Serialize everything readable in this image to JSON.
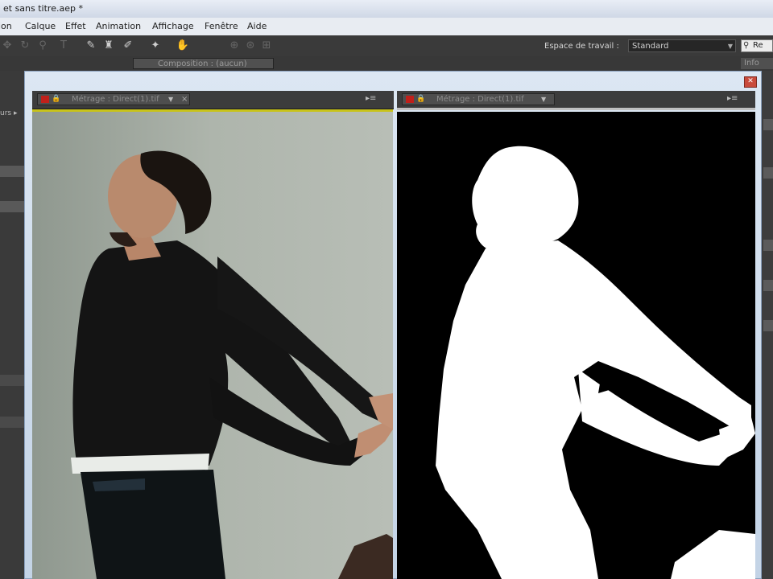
{
  "window": {
    "title": "et sans titre.aep *"
  },
  "menu": {
    "items": [
      "ion",
      "Calque",
      "Effet",
      "Animation",
      "Affichage",
      "Fenêtre",
      "Aide"
    ]
  },
  "toolbar": {
    "workspace_label": "Espace de travail :",
    "workspace_value": "Standard",
    "search_value": "Re"
  },
  "panels": {
    "composition_tab": "Composition : (aucun)",
    "info_tab": "Info"
  },
  "viewers": {
    "left_tab": "Métrage : Direct(1).tif",
    "right_tab": "Métrage : Direct(1).tif"
  },
  "left_panel": {
    "text_fragment": "urs ▸"
  },
  "colors": {
    "active_highlight": "#c8c31a",
    "matte_white": "#ffffff",
    "matte_black": "#000000"
  }
}
